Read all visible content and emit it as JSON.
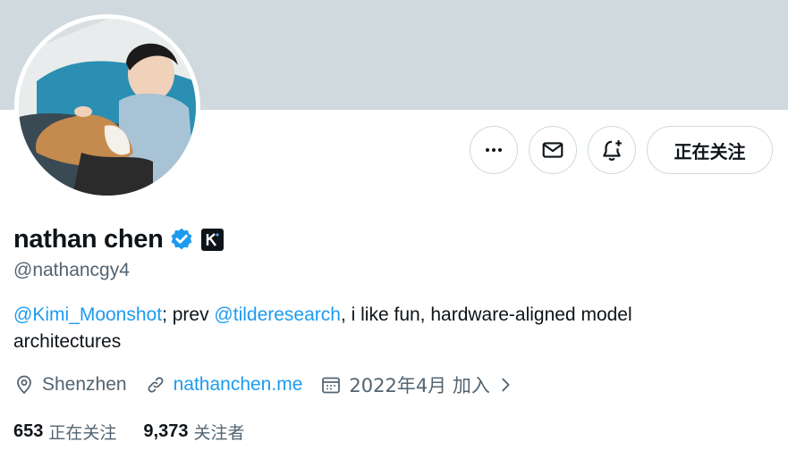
{
  "profile": {
    "display_name": "nathan chen",
    "handle": "@nathancgy4",
    "bio": {
      "mention1": "@Kimi_Moonshot",
      "text1": "; prev ",
      "mention2": "@tilderesearch",
      "text2": ", i like fun, hardware-aligned model architectures"
    },
    "location": "Shenzhen",
    "website": "nathanchen.me",
    "joined": "2022年4月 加入",
    "following_count": "653",
    "following_label": "正在关注",
    "followers_count": "9,373",
    "followers_label": "关注者"
  },
  "actions": {
    "follow_state_label": "正在关注"
  },
  "icons": {
    "more": "more-dots-icon",
    "message": "envelope-icon",
    "notify": "bell-plus-icon",
    "verified": "verified-badge-icon",
    "affiliate": "kimi-affiliate-icon",
    "location": "location-pin-icon",
    "link": "link-icon",
    "calendar": "calendar-icon",
    "chevron": "chevron-right-icon"
  },
  "colors": {
    "accent": "#1d9bf0",
    "banner": "#cfd9de",
    "secondary_text": "#536471"
  }
}
